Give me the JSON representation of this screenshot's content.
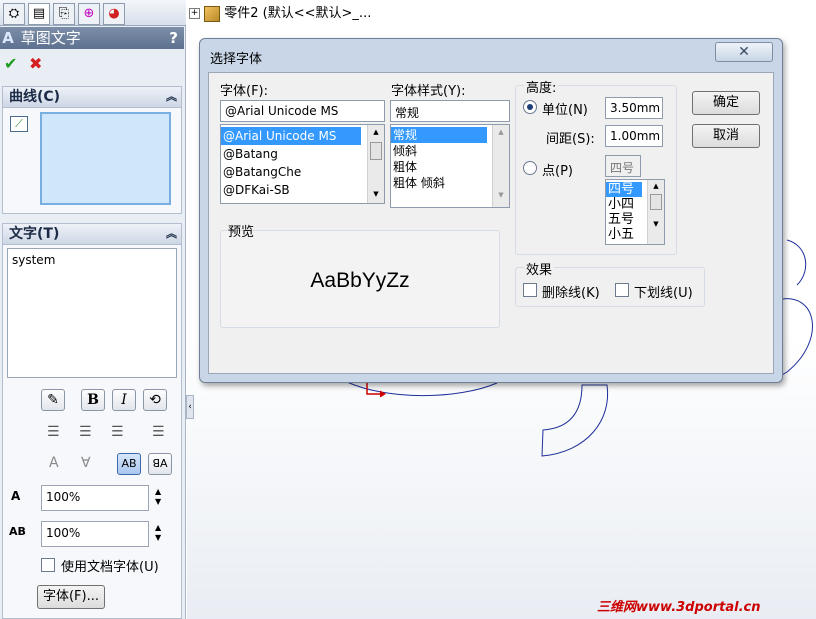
{
  "tree": {
    "label": "零件2  (默认<<默认>_..."
  },
  "panel": {
    "title": "草图文字",
    "help": "?",
    "curve_section": "曲线(C)",
    "text_section": "文字(T)",
    "text_value": "system",
    "width_value": "100%",
    "spacing_value": "100%",
    "use_doc_font_label": "使用文档字体(U)",
    "font_button": "字体(F)...",
    "format_buttons": {
      "bold": "B",
      "italic": "I"
    }
  },
  "dialog": {
    "title": "选择字体",
    "font_label": "字体(F):",
    "font_value": "@Arial Unicode MS",
    "font_list": [
      "@Arial Unicode MS",
      "@Batang",
      "@BatangChe",
      "@DFKai-SB"
    ],
    "style_label": "字体样式(Y):",
    "style_value": "常规",
    "style_list": [
      "常规",
      "倾斜",
      "粗体",
      "粗体 倾斜"
    ],
    "height_label": "高度:",
    "unit_label": "单位(N)",
    "unit_value": "3.50mm",
    "spacing_label": "间距(S):",
    "spacing_value": "1.00mm",
    "point_label": "点(P)",
    "point_value": "四号",
    "point_list": [
      "四号",
      "小四",
      "五号",
      "小五"
    ],
    "ok_label": "确定",
    "cancel_label": "取消",
    "preview_label": "预览",
    "preview_text": "AaBbYyZz",
    "effects_label": "效果",
    "strike_label": "删除线(K)",
    "underline_label": "下划线(U)"
  },
  "watermark": "三维网www.3dportal.cn",
  "colors": {
    "accent": "#3399ff",
    "panel": "#e9eef5",
    "watermark": "#cc0000",
    "sketch": "#1f2f9a"
  }
}
